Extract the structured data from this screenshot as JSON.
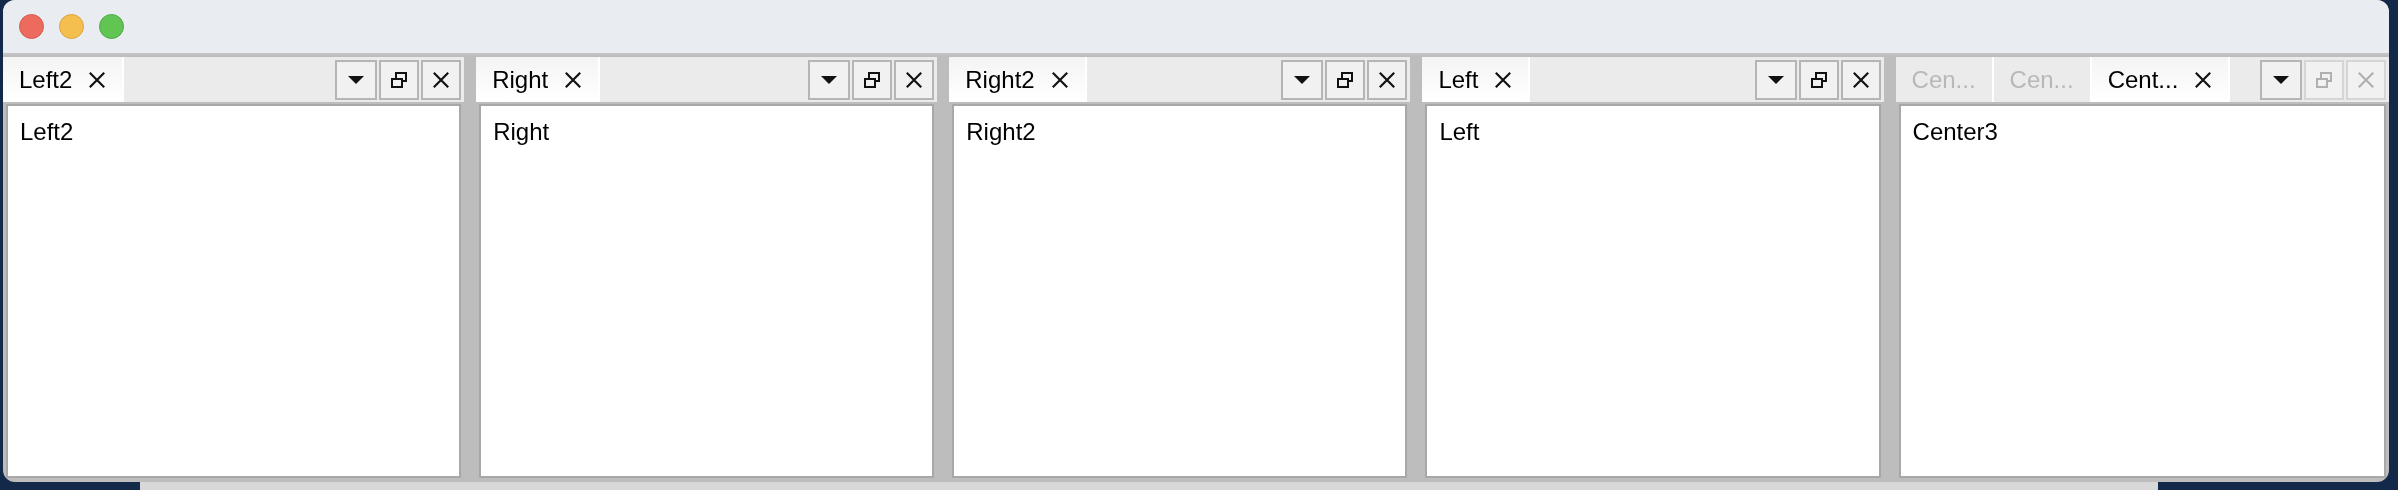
{
  "panes": [
    {
      "tabs": [
        {
          "label": "Left2",
          "selected": true,
          "closable": true
        }
      ],
      "content": "Left2",
      "buttons_disabled": false
    },
    {
      "tabs": [
        {
          "label": "Right",
          "selected": true,
          "closable": true
        }
      ],
      "content": "Right",
      "buttons_disabled": false
    },
    {
      "tabs": [
        {
          "label": "Right2",
          "selected": true,
          "closable": true
        }
      ],
      "content": "Right2",
      "buttons_disabled": false
    },
    {
      "tabs": [
        {
          "label": "Left",
          "selected": true,
          "closable": true
        }
      ],
      "content": "Left",
      "buttons_disabled": false
    },
    {
      "tabs": [
        {
          "label": "Cen...",
          "selected": false,
          "closable": false
        },
        {
          "label": "Cen...",
          "selected": false,
          "closable": false
        },
        {
          "label": "Cent...",
          "selected": true,
          "closable": true
        }
      ],
      "content": "Center3",
      "buttons_disabled": true
    }
  ]
}
